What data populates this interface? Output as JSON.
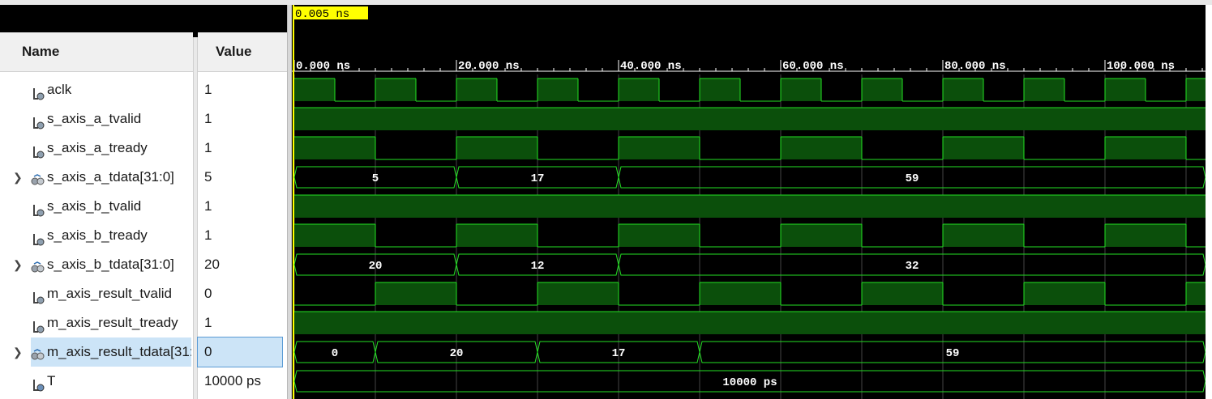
{
  "cursor": {
    "label": "0.005 ns"
  },
  "columns": {
    "name": "Name",
    "value": "Value"
  },
  "ruler": {
    "ticks": [
      "0.000 ns",
      "20.000 ns",
      "40.000 ns",
      "60.000 ns",
      "80.000 ns",
      "100.000 ns"
    ]
  },
  "signals": [
    {
      "name": "aclk",
      "value": "1",
      "kind": "bit",
      "expandable": false
    },
    {
      "name": "s_axis_a_tvalid",
      "value": "1",
      "kind": "bit",
      "expandable": false
    },
    {
      "name": "s_axis_a_tready",
      "value": "1",
      "kind": "bit",
      "expandable": false
    },
    {
      "name": "s_axis_a_tdata[31:0]",
      "value": "5",
      "kind": "bus",
      "expandable": true
    },
    {
      "name": "s_axis_b_tvalid",
      "value": "1",
      "kind": "bit",
      "expandable": false
    },
    {
      "name": "s_axis_b_tready",
      "value": "1",
      "kind": "bit",
      "expandable": false
    },
    {
      "name": "s_axis_b_tdata[31:0]",
      "value": "20",
      "kind": "bus",
      "expandable": true
    },
    {
      "name": "m_axis_result_tvalid",
      "value": "0",
      "kind": "bit",
      "expandable": false
    },
    {
      "name": "m_axis_result_tready",
      "value": "1",
      "kind": "bit",
      "expandable": false
    },
    {
      "name": "m_axis_result_tdata[31:",
      "value": "0",
      "kind": "bus",
      "expandable": true,
      "selected": true
    },
    {
      "name": "T",
      "value": "10000 ps",
      "kind": "param",
      "expandable": false
    }
  ],
  "waves": {
    "time_unit": "ns",
    "aclk": {
      "period": 10,
      "high_first": true
    },
    "s_axis_a_tvalid": [
      [
        0,
        1
      ]
    ],
    "s_axis_a_tready": [
      [
        0,
        1
      ],
      [
        10,
        0
      ],
      [
        20,
        1
      ],
      [
        30,
        0
      ],
      [
        40,
        1
      ],
      [
        50,
        0
      ],
      [
        60,
        1
      ],
      [
        70,
        0
      ],
      [
        80,
        1
      ],
      [
        90,
        0
      ],
      [
        100,
        1
      ],
      [
        110,
        0
      ]
    ],
    "s_axis_a_tdata": [
      {
        "t": 0,
        "v": "5"
      },
      {
        "t": 20,
        "v": "17"
      },
      {
        "t": 40,
        "v": "59"
      }
    ],
    "s_axis_b_tvalid": [
      [
        0,
        1
      ]
    ],
    "s_axis_b_tready": [
      [
        0,
        1
      ],
      [
        10,
        0
      ],
      [
        20,
        1
      ],
      [
        30,
        0
      ],
      [
        40,
        1
      ],
      [
        50,
        0
      ],
      [
        60,
        1
      ],
      [
        70,
        0
      ],
      [
        80,
        1
      ],
      [
        90,
        0
      ],
      [
        100,
        1
      ],
      [
        110,
        0
      ]
    ],
    "s_axis_b_tdata": [
      {
        "t": 0,
        "v": "20"
      },
      {
        "t": 20,
        "v": "12"
      },
      {
        "t": 40,
        "v": "32"
      }
    ],
    "m_axis_result_tvalid": [
      [
        0,
        0
      ],
      [
        10,
        1
      ],
      [
        20,
        0
      ],
      [
        30,
        1
      ],
      [
        40,
        0
      ],
      [
        50,
        1
      ],
      [
        60,
        0
      ],
      [
        70,
        1
      ],
      [
        80,
        0
      ],
      [
        90,
        1
      ],
      [
        100,
        0
      ],
      [
        110,
        1
      ]
    ],
    "m_axis_result_tready": [
      [
        0,
        1
      ]
    ],
    "m_axis_result_tdata": [
      {
        "t": 0,
        "v": "0"
      },
      {
        "t": 10,
        "v": "20"
      },
      {
        "t": 30,
        "v": "17"
      },
      {
        "t": 50,
        "v": "59"
      }
    ],
    "T": [
      {
        "t": 0,
        "v": "10000 ps"
      }
    ]
  },
  "colors": {
    "wave_fill": "#0b4f0b",
    "wave_line": "#23e023",
    "background": "#000000",
    "ruler_text": "#ffffff",
    "cursor_bg": "#ffff00",
    "cursor_line": "#ffff00"
  },
  "icons": {
    "bit": "bit-signal-icon",
    "bus": "bus-signal-icon",
    "param": "parameter-icon",
    "expand": "chevron-right-icon"
  }
}
